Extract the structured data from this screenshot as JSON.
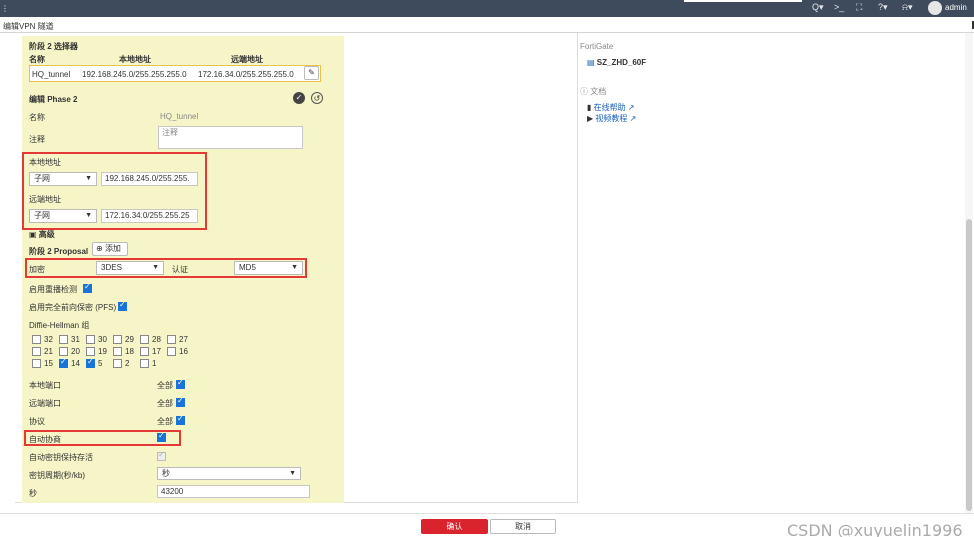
{
  "topbar": {
    "icons": [
      {
        "name": "search-icon",
        "glyph": "Q▾"
      },
      {
        "name": "cli-icon",
        "glyph": ">_"
      },
      {
        "name": "fullscreen-icon",
        "glyph": "⛶"
      },
      {
        "name": "help-icon",
        "glyph": "?▾"
      },
      {
        "name": "bell-icon",
        "glyph": "⍾▾"
      }
    ],
    "user": "admin",
    "avatar_icon": "user-avatar-icon"
  },
  "title": "编辑VPN 隧道",
  "selector": {
    "heading": "阶段 2 选择器",
    "col_name": "名称",
    "col_local": "本地地址",
    "col_remote": "远端地址",
    "row": {
      "name": "HQ_tunnel",
      "local": "192.168.245.0/255.255.255.0",
      "remote": "172.16.34.0/255.255.255.0"
    }
  },
  "edit": {
    "heading": "编辑 Phase 2",
    "name_label": "名称",
    "name_value": "HQ_tunnel",
    "comment_label": "注释",
    "comment_placeholder": "注释",
    "local_label": "本地地址",
    "local_type": "子网",
    "local_value": "192.168.245.0/255.255.",
    "remote_label": "远端地址",
    "remote_type": "子网",
    "remote_value": "172.16.34.0/255.255.25",
    "advanced_label": "高级",
    "proposal_label": "阶段 2 Proposal",
    "add_label": "添加",
    "encrypt_label": "加密",
    "encrypt_value": "3DES",
    "auth_label": "认证",
    "auth_value": "MD5",
    "replay_label": "启用重播检测",
    "pfs_label": "启用完全前向保密 (PFS)",
    "dh_label": "Diffie-Hellman 组",
    "dh_groups": [
      {
        "value": "32",
        "checked": false
      },
      {
        "value": "31",
        "checked": false
      },
      {
        "value": "30",
        "checked": false
      },
      {
        "value": "29",
        "checked": false
      },
      {
        "value": "28",
        "checked": false
      },
      {
        "value": "27",
        "checked": false
      },
      {
        "value": "21",
        "checked": false
      },
      {
        "value": "20",
        "checked": false
      },
      {
        "value": "19",
        "checked": false
      },
      {
        "value": "18",
        "checked": false
      },
      {
        "value": "17",
        "checked": false
      },
      {
        "value": "16",
        "checked": false
      },
      {
        "value": "15",
        "checked": false
      },
      {
        "value": "14",
        "checked": true
      },
      {
        "value": "5",
        "checked": true
      },
      {
        "value": "2",
        "checked": false
      },
      {
        "value": "1",
        "checked": false
      }
    ],
    "local_port_label": "本地端口",
    "remote_port_label": "远端端口",
    "protocol_label": "协议",
    "all_label": "全部",
    "autoneg_label": "自动协商",
    "keepalive_label": "自动密钥保持存活",
    "keylife_label": "密钥周期(秒/kb)",
    "keylife_unit": "秒",
    "seconds_label": "秒",
    "seconds_value": "43200"
  },
  "right": {
    "device_title": "FortiGate",
    "device_name": "SZ_ZHD_60F",
    "docs_title": "文档",
    "online_help": "在线帮助",
    "video_tutorial": "视频教程"
  },
  "footer": {
    "ok": "确认",
    "cancel": "取消",
    "watermark": "CSDN @xuyuelin1996"
  },
  "colors": {
    "accent": "#d9232d",
    "highlight_box": "#e53935",
    "panel": "#f5f5c8",
    "topbar": "#3d4b5c",
    "checkbox": "#1a73d9"
  }
}
